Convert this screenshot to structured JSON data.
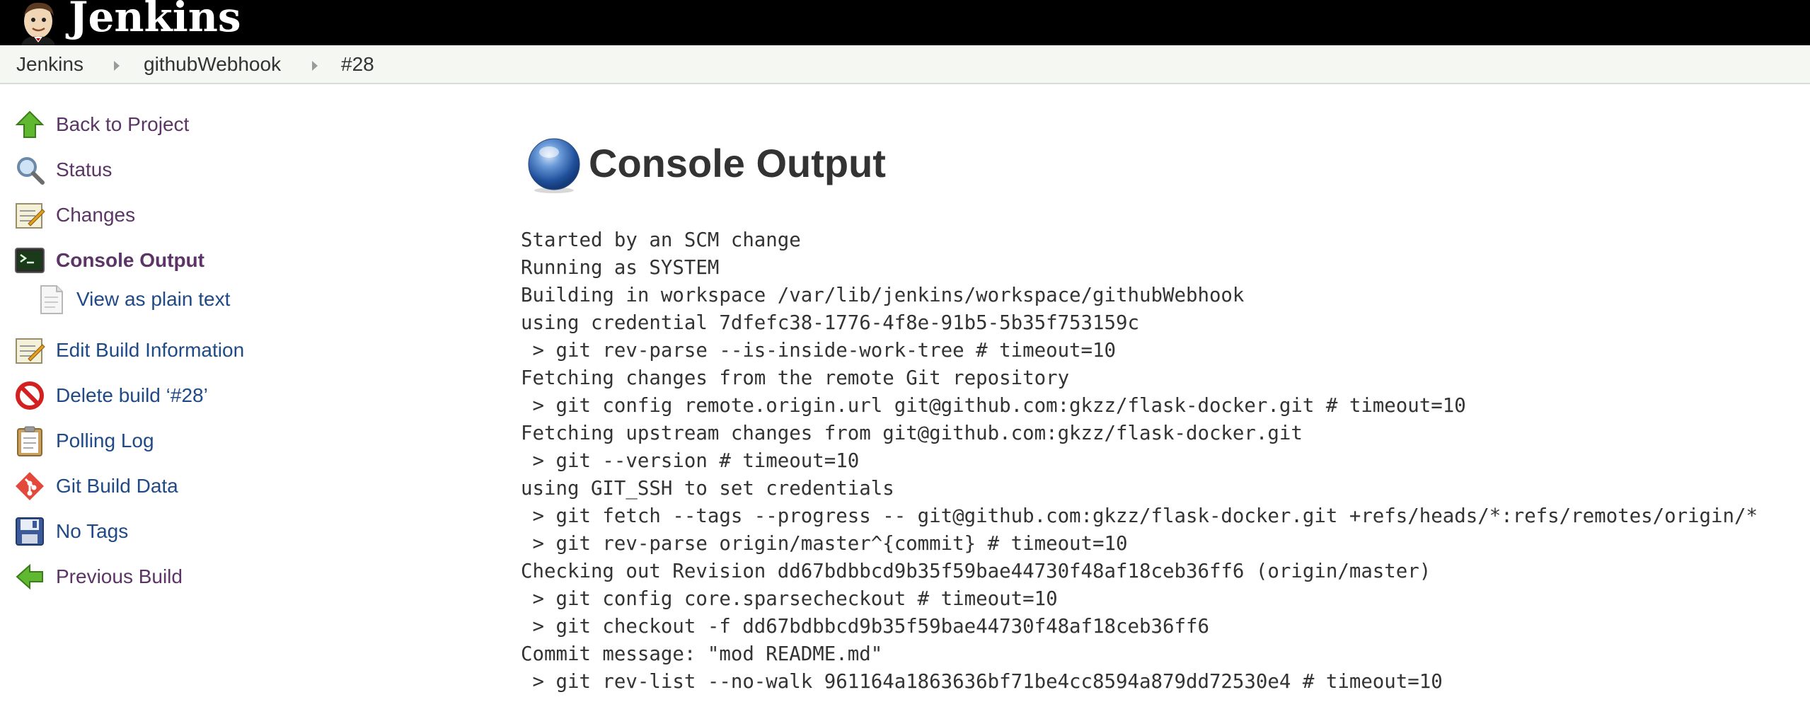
{
  "header": {
    "brand": "Jenkins"
  },
  "breadcrumb": {
    "items": [
      "Jenkins",
      "githubWebhook",
      "#28"
    ]
  },
  "sidebar": {
    "items": [
      {
        "label": "Back to Project",
        "icon": "up-arrow-icon"
      },
      {
        "label": "Status",
        "icon": "magnifier-icon"
      },
      {
        "label": "Changes",
        "icon": "notepad-icon"
      },
      {
        "label": "Console Output",
        "icon": "terminal-icon"
      },
      {
        "label": "View as plain text",
        "icon": "document-icon"
      },
      {
        "label": "Edit Build Information",
        "icon": "notepad-icon"
      },
      {
        "label": "Delete build ‘#28’",
        "icon": "no-entry-icon"
      },
      {
        "label": "Polling Log",
        "icon": "clipboard-icon"
      },
      {
        "label": "Git Build Data",
        "icon": "git-icon"
      },
      {
        "label": "No Tags",
        "icon": "floppy-disk-icon"
      },
      {
        "label": "Previous Build",
        "icon": "left-arrow-icon"
      }
    ]
  },
  "main": {
    "title": "Console Output",
    "title_icon": "blue-ball-icon",
    "console_lines": [
      "Started by an SCM change",
      "Running as SYSTEM",
      "Building in workspace /var/lib/jenkins/workspace/githubWebhook",
      "using credential 7dfefc38-1776-4f8e-91b5-5b35f753159c",
      " > git rev-parse --is-inside-work-tree # timeout=10",
      "Fetching changes from the remote Git repository",
      " > git config remote.origin.url git@github.com:gkzz/flask-docker.git # timeout=10",
      "Fetching upstream changes from git@github.com:gkzz/flask-docker.git",
      " > git --version # timeout=10",
      "using GIT_SSH to set credentials",
      " > git fetch --tags --progress -- git@github.com:gkzz/flask-docker.git +refs/heads/*:refs/remotes/origin/*",
      " > git rev-parse origin/master^{commit} # timeout=10",
      "Checking out Revision dd67bdbbcd9b35f59bae44730f48af18ceb36ff6 (origin/master)",
      " > git config core.sparsecheckout # timeout=10",
      " > git checkout -f dd67bdbbcd9b35f59bae44730f48af18ceb36ff6",
      "Commit message: \"mod README.md\"",
      " > git rev-list --no-walk 961164a1863636bf71be4cc8594a879dd72530e4 # timeout=10"
    ]
  },
  "colors": {
    "header_bg": "#000000",
    "breadcrumb_bg": "#f5f7f3",
    "link": "#204a87",
    "visited_link": "#5c3566",
    "text": "#333333"
  }
}
